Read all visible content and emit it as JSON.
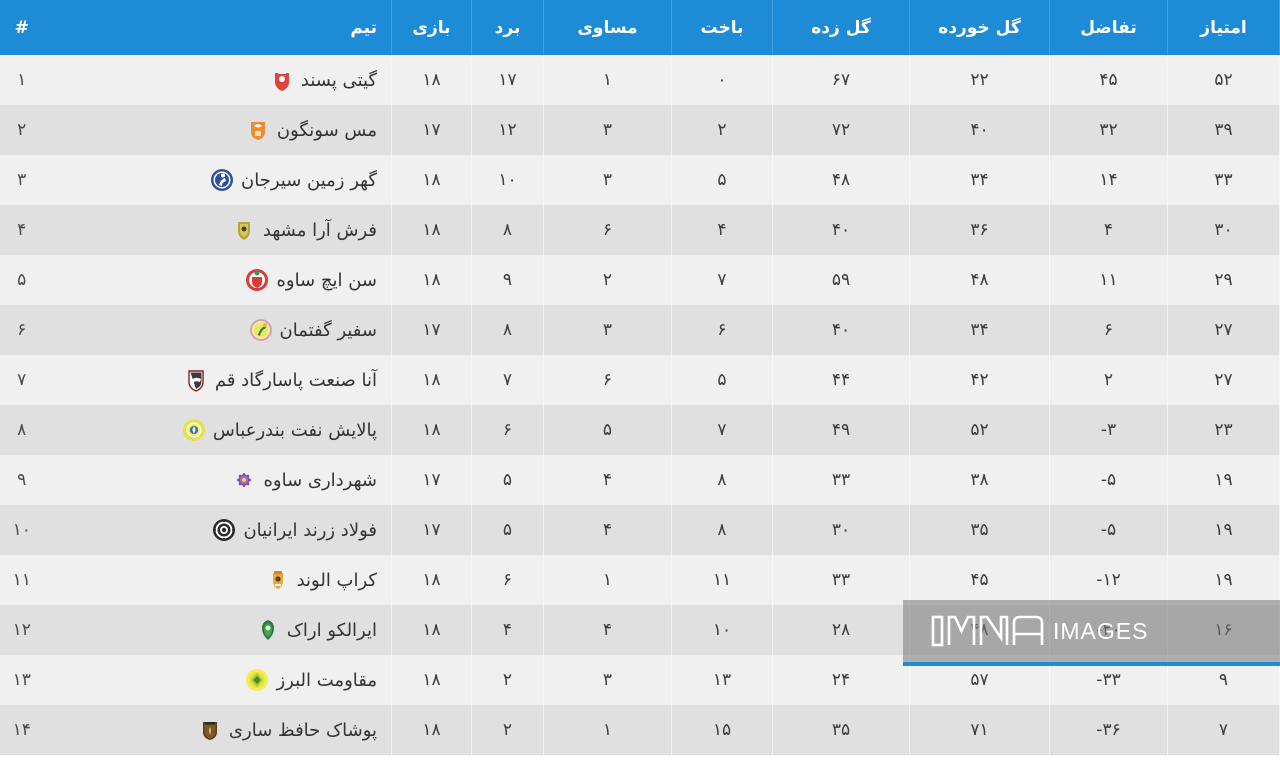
{
  "table": {
    "headers": {
      "rank": "#",
      "team": "تیم",
      "played": "بازی",
      "win": "برد",
      "draw": "مساوی",
      "lost": "باخت",
      "goals_for": "گل زده",
      "goals_against": "گل خورده",
      "goal_difference": "تفاضل",
      "points": "امتیاز"
    },
    "header_bg": "#1e8bd6",
    "row_odd_bg": "#f0f0f0",
    "row_even_bg": "#e0e0e0",
    "rows": [
      {
        "rank": "۱",
        "team": "گیتی پسند",
        "logo": "giti-pasand-crest-icon",
        "played": "۱۸",
        "win": "۱۷",
        "draw": "۱",
        "lost": "۰",
        "goals_for": "۶۷",
        "goals_against": "۲۲",
        "goal_difference": "۴۵",
        "points": "۵۲"
      },
      {
        "rank": "۲",
        "team": "مس سونگون",
        "logo": "mes-sungun-crest-icon",
        "played": "۱۷",
        "win": "۱۲",
        "draw": "۳",
        "lost": "۲",
        "goals_for": "۷۲",
        "goals_against": "۴۰",
        "goal_difference": "۳۲",
        "points": "۳۹"
      },
      {
        "rank": "۳",
        "team": "گهر زمین سیرجان",
        "logo": "gohar-zamin-sirjan-crest-icon",
        "played": "۱۸",
        "win": "۱۰",
        "draw": "۳",
        "lost": "۵",
        "goals_for": "۴۸",
        "goals_against": "۳۴",
        "goal_difference": "۱۴",
        "points": "۳۳"
      },
      {
        "rank": "۴",
        "team": "فرش آرا مشهد",
        "logo": "farsh-ara-mashhad-crest-icon",
        "played": "۱۸",
        "win": "۸",
        "draw": "۶",
        "lost": "۴",
        "goals_for": "۴۰",
        "goals_against": "۳۶",
        "goal_difference": "۴",
        "points": "۳۰"
      },
      {
        "rank": "۵",
        "team": "سن ایچ ساوه",
        "logo": "sunich-saveh-crest-icon",
        "played": "۱۸",
        "win": "۹",
        "draw": "۲",
        "lost": "۷",
        "goals_for": "۵۹",
        "goals_against": "۴۸",
        "goal_difference": "۱۱",
        "points": "۲۹"
      },
      {
        "rank": "۶",
        "team": "سفیر گفتمان",
        "logo": "safir-goftman-crest-icon",
        "played": "۱۷",
        "win": "۸",
        "draw": "۳",
        "lost": "۶",
        "goals_for": "۴۰",
        "goals_against": "۳۴",
        "goal_difference": "۶",
        "points": "۲۷"
      },
      {
        "rank": "۷",
        "team": "آنا صنعت پاسارگاد قم",
        "logo": "ana-sanat-pasargad-qom-crest-icon",
        "played": "۱۸",
        "win": "۷",
        "draw": "۶",
        "lost": "۵",
        "goals_for": "۴۴",
        "goals_against": "۴۲",
        "goal_difference": "۲",
        "points": "۲۷"
      },
      {
        "rank": "۸",
        "team": "پالایش نفت بندرعباس",
        "logo": "palayesh-naft-bandar-abbas-crest-icon",
        "played": "۱۸",
        "win": "۶",
        "draw": "۵",
        "lost": "۷",
        "goals_for": "۴۹",
        "goals_against": "۵۲",
        "goal_difference": "۳-",
        "points": "۲۳"
      },
      {
        "rank": "۹",
        "team": "شهرداری ساوه",
        "logo": "shahrdari-saveh-crest-icon",
        "played": "۱۷",
        "win": "۵",
        "draw": "۴",
        "lost": "۸",
        "goals_for": "۳۳",
        "goals_against": "۳۸",
        "goal_difference": "۵-",
        "points": "۱۹"
      },
      {
        "rank": "۱۰",
        "team": "فولاد زرند ایرانیان",
        "logo": "foolad-zarand-iranian-crest-icon",
        "played": "۱۷",
        "win": "۵",
        "draw": "۴",
        "lost": "۸",
        "goals_for": "۳۰",
        "goals_against": "۳۵",
        "goal_difference": "۵-",
        "points": "۱۹"
      },
      {
        "rank": "۱۱",
        "team": "کراپ الوند",
        "logo": "crop-alvand-crest-icon",
        "played": "۱۸",
        "win": "۶",
        "draw": "۱",
        "lost": "۱۱",
        "goals_for": "۳۳",
        "goals_against": "۴۵",
        "goal_difference": "۱۲-",
        "points": "۱۹"
      },
      {
        "rank": "۱۲",
        "team": "ایرالکو اراک",
        "logo": "iralco-arak-crest-icon",
        "played": "۱۸",
        "win": "۴",
        "draw": "۴",
        "lost": "۱۰",
        "goals_for": "۲۸",
        "goals_against": "۴۸",
        "goal_difference": "۲۰-",
        "points": "۱۶"
      },
      {
        "rank": "۱۳",
        "team": "مقاومت البرز",
        "logo": "moghavemat-alborz-crest-icon",
        "played": "۱۸",
        "win": "۲",
        "draw": "۳",
        "lost": "۱۳",
        "goals_for": "۲۴",
        "goals_against": "۵۷",
        "goal_difference": "۳۳-",
        "points": "۹"
      },
      {
        "rank": "۱۴",
        "team": "پوشاک حافظ ساری",
        "logo": "pooshak-hafez-sari-crest-icon",
        "played": "۱۸",
        "win": "۲",
        "draw": "۱",
        "lost": "۱۵",
        "goals_for": "۳۵",
        "goals_against": "۷۱",
        "goal_difference": "۳۶-",
        "points": "۷"
      }
    ]
  },
  "watermark": {
    "brand": "IMNA",
    "label": "IMAGES",
    "accent": "#1e8bd6"
  }
}
